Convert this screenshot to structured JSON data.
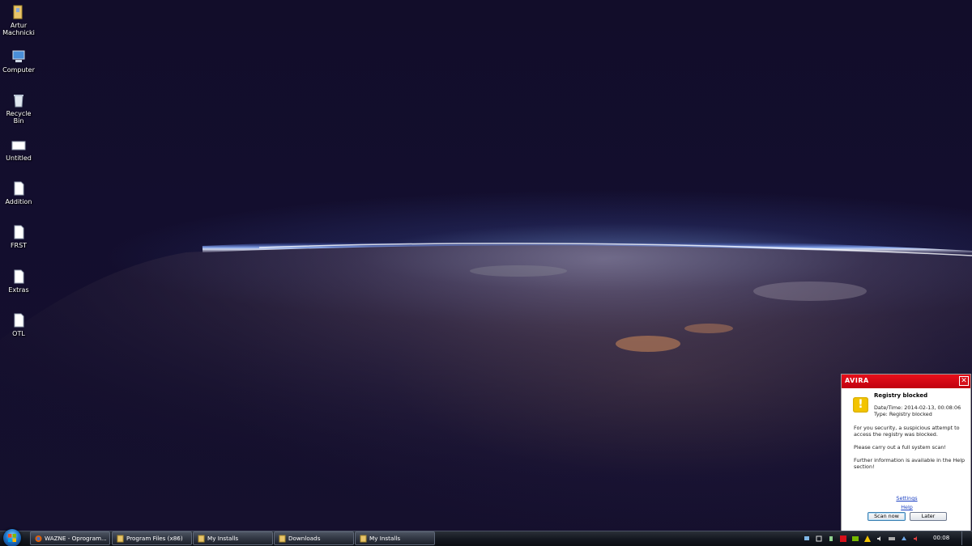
{
  "desktop": {
    "icons": [
      {
        "label": "Artur\nMachnicki",
        "icon": "user-folder-icon"
      },
      {
        "label": "Computer",
        "icon": "computer-icon"
      },
      {
        "label": "Recycle Bin",
        "icon": "recycle-bin-icon"
      },
      {
        "label": "Untitled",
        "icon": "image-file-icon"
      },
      {
        "label": "Addition",
        "icon": "text-file-icon"
      },
      {
        "label": "FRST",
        "icon": "text-file-icon"
      },
      {
        "label": "Extras",
        "icon": "text-file-icon"
      },
      {
        "label": "OTL",
        "icon": "text-file-icon"
      }
    ]
  },
  "avira": {
    "brand": "AVIRA",
    "close_symbol": "✕",
    "title": "Registry blocked",
    "datetime": "Date/Time: 2014-02-13, 00:08:06",
    "type": "Type: Registry blocked",
    "message1": "For you security, a suspicious attempt to access the registry was blocked.",
    "message2": "Please carry out a full system scan!",
    "message3": "Further information is available in the Help section!",
    "settings_link": "Settings",
    "help_link": "Help",
    "scan_button": "Scan now",
    "later_button": "Later",
    "accent": "#d6101a"
  },
  "taskbar": {
    "items": [
      {
        "label": "WAZNE - Oprogram...",
        "icon": "firefox-icon"
      },
      {
        "label": "Program Files (x86)",
        "icon": "folder-icon"
      },
      {
        "label": "My Installs",
        "icon": "folder-icon"
      },
      {
        "label": "Downloads",
        "icon": "folder-icon"
      },
      {
        "label": "My Installs",
        "icon": "folder-icon"
      }
    ],
    "clock": "00:08"
  }
}
